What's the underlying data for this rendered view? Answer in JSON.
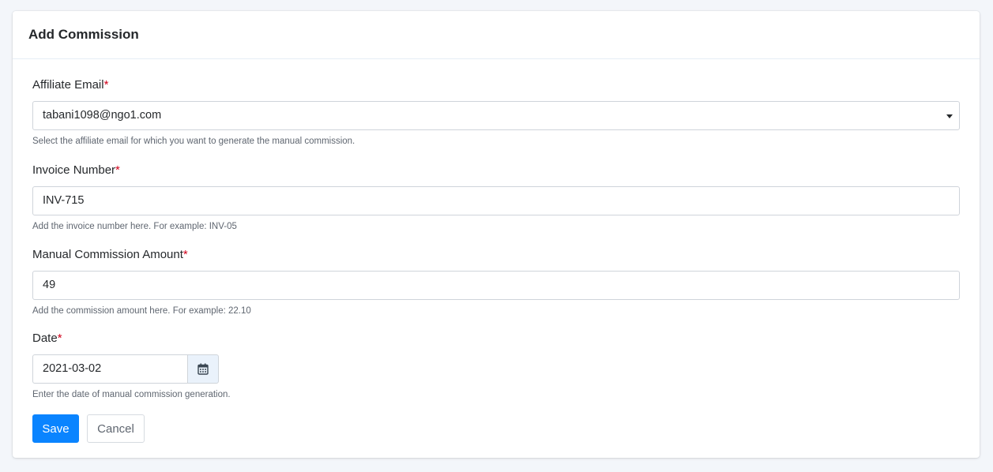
{
  "header": {
    "title": "Add Commission"
  },
  "fields": {
    "affiliate_email": {
      "label": "Affiliate Email",
      "required_mark": "*",
      "value": "tabani1098@ngo1.com",
      "help": "Select the affiliate email for which you want to generate the manual commission."
    },
    "invoice_number": {
      "label": "Invoice Number",
      "required_mark": "*",
      "value": "INV-715",
      "help": "Add the invoice number here. For example: INV-05"
    },
    "commission_amount": {
      "label": "Manual Commission Amount",
      "required_mark": "*",
      "value": "49",
      "help": "Add the commission amount here. For example: 22.10"
    },
    "date": {
      "label": "Date",
      "required_mark": "*",
      "value": "2021-03-02",
      "help": "Enter the date of manual commission generation."
    }
  },
  "actions": {
    "save_label": "Save",
    "cancel_label": "Cancel"
  },
  "icons": {
    "date_picker": "calendar-icon",
    "select_caret": "caret-down-icon"
  },
  "colors": {
    "primary": "#0a84ff",
    "required": "#d0021b",
    "page_background": "#f3f6fa"
  }
}
